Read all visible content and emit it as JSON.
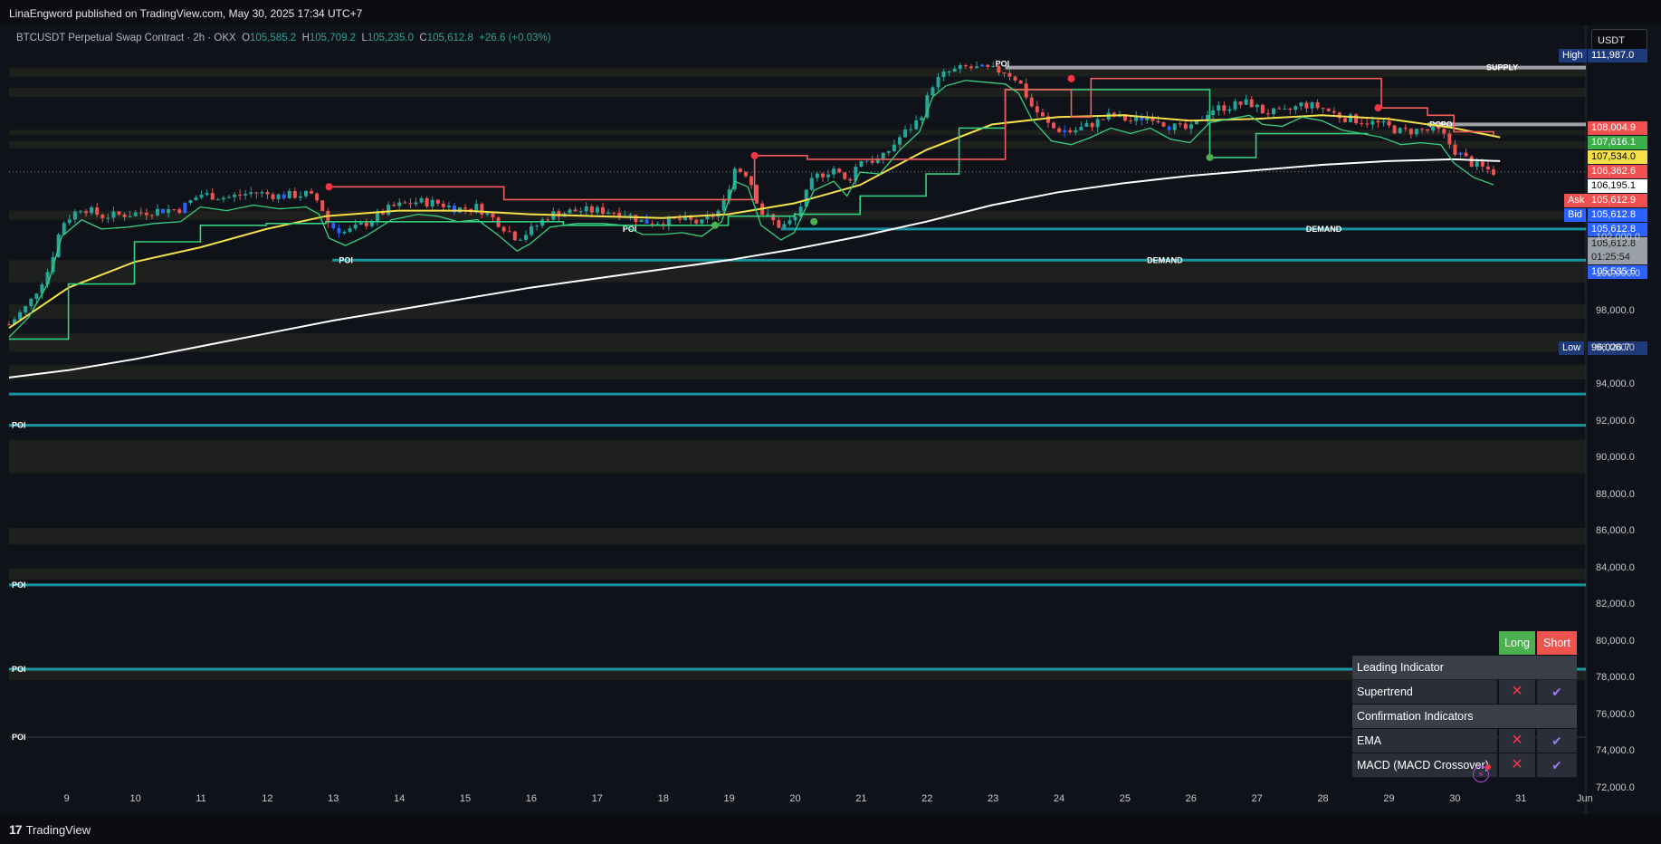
{
  "header": {
    "published": "LinaEngword published on TradingView.com, May 30, 2025 17:34 UTC+7"
  },
  "legend": {
    "symbol": "BTCUSDT Perpetual Swap Contract · 2h · OKX",
    "open_label": "O",
    "open": "105,585.2",
    "high_label": "H",
    "high": "105,709.2",
    "low_label": "L",
    "low": "105,235.0",
    "close_label": "C",
    "close": "105,612.8",
    "change": "+26.6 (+0.03%)"
  },
  "currency_button": "USDT",
  "footer": {
    "brand": "TradingView"
  },
  "colors": {
    "background": "#0f1219",
    "up": "#26a69a",
    "down": "#ef5350",
    "ema_fast": "#f5e04a",
    "ema_slow": "#ffffff",
    "supertrend_up": "#35d07f",
    "supertrend_down": "#f25c5c",
    "demand_line": "#1aa3b0"
  },
  "price_labels": [
    {
      "tag": "High",
      "value": "111,987.0",
      "price": 111987,
      "bg": "#1e3a78",
      "fg": "#ffffff"
    },
    {
      "tag": "",
      "value": "108,004.9",
      "price": 108004.9,
      "bg": "#f05050",
      "fg": "#ffffff"
    },
    {
      "tag": "",
      "value": "107,616.1",
      "price": 107616.1,
      "bg": "#3bb04a",
      "fg": "#ffffff"
    },
    {
      "tag": "",
      "value": "107,534.0",
      "price": 107534.0,
      "bg": "#f5e04a",
      "fg": "#000000"
    },
    {
      "tag": "",
      "value": "106,362.6",
      "price": 106362.6,
      "bg": "#f05050",
      "fg": "#ffffff"
    },
    {
      "tag": "",
      "value": "106,195.1",
      "price": 106195.1,
      "bg": "#ffffff",
      "fg": "#000000"
    },
    {
      "tag": "Ask",
      "value": "105,612.9",
      "price": 105612.9,
      "bg": "#f05050",
      "fg": "#ffffff"
    },
    {
      "tag": "Bid",
      "value": "105,612.8",
      "price": 105612.8,
      "bg": "#2962ff",
      "fg": "#ffffff"
    },
    {
      "tag": "",
      "value": "105,612.8",
      "price": 105612.8,
      "bg": "#2962ff",
      "fg": "#ffffff"
    },
    {
      "tag": "",
      "value": "105,612.8",
      "price": 105612.8,
      "bg": "#9aa0a8",
      "fg": "#1a1a1a",
      "countdown": "01:25:54"
    },
    {
      "tag": "",
      "value": "105,535.6",
      "price": 105535.6,
      "bg": "#2962ff",
      "fg": "#ffffff"
    },
    {
      "tag": "Low",
      "value": "96,026.7",
      "price": 96026.7,
      "bg": "#1e3a78",
      "fg": "#ffffff"
    }
  ],
  "signal_table": {
    "header_long": "Long",
    "header_short": "Short",
    "rows": [
      {
        "kind": "section",
        "label": "Leading Indicator"
      },
      {
        "kind": "item",
        "label": "Supertrend",
        "long": "✕",
        "short": "✔"
      },
      {
        "kind": "section",
        "label": "Confirmation Indicators"
      },
      {
        "kind": "item",
        "label": "EMA",
        "long": "✕",
        "short": "✔"
      },
      {
        "kind": "item",
        "label": "MACD (MACD Crossover)",
        "long": "✕",
        "short": "✔"
      }
    ]
  },
  "chart_data": {
    "type": "candlestick",
    "symbol": "BTCUSDT Perpetual Swap Contract",
    "interval": "2h",
    "exchange": "OKX",
    "ylim": [
      70800,
      113600
    ],
    "y_ticks": [
      72000,
      74000,
      76000,
      78000,
      80000,
      82000,
      84000,
      86000,
      88000,
      90000,
      92000,
      94000,
      96000,
      98000,
      100000,
      102000
    ],
    "y_tick_labels": [
      "72,000.0",
      "74,000.0",
      "76,000.0",
      "78,000.0",
      "80,000.0",
      "82,000.0",
      "84,000.0",
      "86,000.0",
      "88,000.0",
      "90,000.0",
      "92,000.0",
      "94,000.0",
      "96,000.0",
      "98,000.0",
      "100,000.0",
      "102,000.0"
    ],
    "x_ticks": [
      "9",
      "10",
      "11",
      "12",
      "13",
      "14",
      "15",
      "16",
      "17",
      "18",
      "19",
      "20",
      "21",
      "22",
      "23",
      "24",
      "25",
      "26",
      "27",
      "28",
      "29",
      "30",
      "31",
      "Jun"
    ],
    "x_range_days": [
      8.1,
      32.0
    ],
    "close_path": [
      [
        8.1,
        97300
      ],
      [
        8.4,
        98400
      ],
      [
        8.7,
        100300
      ],
      [
        8.9,
        102800
      ],
      [
        9.2,
        103700
      ],
      [
        9.5,
        103200
      ],
      [
        9.9,
        103300
      ],
      [
        10.3,
        103500
      ],
      [
        10.7,
        103600
      ],
      [
        11.0,
        104400
      ],
      [
        11.4,
        104200
      ],
      [
        11.8,
        104500
      ],
      [
        12.2,
        104300
      ],
      [
        12.6,
        104400
      ],
      [
        12.8,
        104000
      ],
      [
        12.95,
        102700
      ],
      [
        13.2,
        102300
      ],
      [
        13.5,
        102800
      ],
      [
        13.9,
        103700
      ],
      [
        14.3,
        104000
      ],
      [
        14.6,
        103900
      ],
      [
        14.9,
        103600
      ],
      [
        15.2,
        103700
      ],
      [
        15.5,
        102900
      ],
      [
        15.8,
        102000
      ],
      [
        16.0,
        102400
      ],
      [
        16.3,
        103300
      ],
      [
        16.7,
        103500
      ],
      [
        17.1,
        103500
      ],
      [
        17.4,
        103400
      ],
      [
        17.7,
        102900
      ],
      [
        18.0,
        102900
      ],
      [
        18.3,
        103000
      ],
      [
        18.6,
        102800
      ],
      [
        18.9,
        103600
      ],
      [
        19.1,
        105800
      ],
      [
        19.3,
        105500
      ],
      [
        19.5,
        103400
      ],
      [
        19.8,
        102600
      ],
      [
        20.0,
        103000
      ],
      [
        20.3,
        105300
      ],
      [
        20.6,
        105800
      ],
      [
        20.8,
        105000
      ],
      [
        21.0,
        106300
      ],
      [
        21.3,
        106200
      ],
      [
        21.6,
        107500
      ],
      [
        21.9,
        108500
      ],
      [
        22.1,
        110400
      ],
      [
        22.3,
        111000
      ],
      [
        22.6,
        111300
      ],
      [
        22.9,
        111200
      ],
      [
        23.2,
        111100
      ],
      [
        23.4,
        110600
      ],
      [
        23.6,
        109200
      ],
      [
        23.9,
        108000
      ],
      [
        24.2,
        107800
      ],
      [
        24.5,
        108200
      ],
      [
        24.8,
        108700
      ],
      [
        25.1,
        108400
      ],
      [
        25.4,
        108700
      ],
      [
        25.7,
        108100
      ],
      [
        26.0,
        107900
      ],
      [
        26.3,
        109000
      ],
      [
        26.6,
        109200
      ],
      [
        26.9,
        109400
      ],
      [
        27.1,
        108900
      ],
      [
        27.4,
        108800
      ],
      [
        27.7,
        109300
      ],
      [
        28.0,
        109100
      ],
      [
        28.3,
        108600
      ],
      [
        28.6,
        108400
      ],
      [
        28.9,
        108200
      ],
      [
        29.2,
        107800
      ],
      [
        29.5,
        107900
      ],
      [
        29.8,
        107800
      ],
      [
        30.0,
        106800
      ],
      [
        30.3,
        106000
      ],
      [
        30.6,
        105612.8
      ]
    ],
    "series": [
      {
        "name": "EMA (fast)",
        "color": "#f5e04a",
        "points": [
          [
            8.1,
            97100
          ],
          [
            9.0,
            99300
          ],
          [
            10.0,
            100700
          ],
          [
            11.0,
            101500
          ],
          [
            12.0,
            102500
          ],
          [
            12.9,
            103200
          ],
          [
            14.0,
            103500
          ],
          [
            15.0,
            103500
          ],
          [
            16.0,
            103300
          ],
          [
            17.0,
            103200
          ],
          [
            18.0,
            103100
          ],
          [
            19.0,
            103300
          ],
          [
            20.0,
            103900
          ],
          [
            21.0,
            104900
          ],
          [
            22.0,
            106800
          ],
          [
            23.0,
            108200
          ],
          [
            24.0,
            108600
          ],
          [
            25.0,
            108700
          ],
          [
            26.0,
            108400
          ],
          [
            27.0,
            108500
          ],
          [
            28.0,
            108700
          ],
          [
            29.0,
            108500
          ],
          [
            30.0,
            108000
          ],
          [
            30.7,
            107500
          ]
        ]
      },
      {
        "name": "EMA (slow)",
        "color": "#ffffff",
        "points": [
          [
            8.1,
            94400
          ],
          [
            9.0,
            94800
          ],
          [
            10.0,
            95400
          ],
          [
            11.0,
            96100
          ],
          [
            12.0,
            96800
          ],
          [
            13.0,
            97500
          ],
          [
            14.0,
            98100
          ],
          [
            15.0,
            98700
          ],
          [
            16.0,
            99300
          ],
          [
            17.0,
            99800
          ],
          [
            18.0,
            100300
          ],
          [
            19.0,
            100800
          ],
          [
            20.0,
            101400
          ],
          [
            21.0,
            102100
          ],
          [
            22.0,
            102900
          ],
          [
            23.0,
            103800
          ],
          [
            24.0,
            104500
          ],
          [
            25.0,
            105000
          ],
          [
            26.0,
            105400
          ],
          [
            27.0,
            105700
          ],
          [
            28.0,
            106000
          ],
          [
            29.0,
            106200
          ],
          [
            30.0,
            106300
          ],
          [
            30.7,
            106200
          ]
        ]
      }
    ],
    "supertrend": {
      "up": [
        [
          8.1,
          96500
        ],
        [
          9.0,
          99500
        ],
        [
          10.0,
          101800
        ],
        [
          11.0,
          102700
        ],
        [
          12.0,
          102800
        ],
        [
          12.9,
          102900
        ],
        [
          16.5,
          102700
        ],
        [
          18.0,
          102700
        ],
        [
          19.0,
          103200
        ],
        [
          20.0,
          103300
        ],
        [
          21.0,
          104300
        ],
        [
          22.0,
          105500
        ],
        [
          22.5,
          108000
        ],
        [
          23.2,
          110100
        ],
        [
          23.7,
          110100
        ],
        [
          26.3,
          106400
        ],
        [
          27.0,
          107700
        ],
        [
          28.0,
          107700
        ],
        [
          28.7,
          107700
        ]
      ],
      "down": [
        [
          12.9,
          104800
        ],
        [
          15.5,
          104800
        ],
        [
          15.6,
          104100
        ],
        [
          18.8,
          104100
        ],
        [
          19.4,
          106500
        ],
        [
          20.2,
          106300
        ],
        [
          21.0,
          106300
        ],
        [
          23.2,
          110100
        ],
        [
          23.6,
          110100
        ],
        [
          24.2,
          108600
        ],
        [
          24.5,
          110700
        ],
        [
          26.0,
          110700
        ],
        [
          26.4,
          110700
        ],
        [
          28.9,
          109100
        ],
        [
          29.6,
          108700
        ],
        [
          30.0,
          107800
        ],
        [
          30.6,
          107600
        ]
      ]
    },
    "signal_dots": [
      {
        "side": "short",
        "x": 12.95,
        "y": 104800
      },
      {
        "side": "short",
        "x": 19.4,
        "y": 106500
      },
      {
        "side": "short",
        "x": 24.2,
        "y": 110700
      },
      {
        "side": "short",
        "x": 28.85,
        "y": 109100
      },
      {
        "side": "long",
        "x": 18.8,
        "y": 102700
      },
      {
        "side": "long",
        "x": 20.3,
        "y": 102900
      },
      {
        "side": "long",
        "x": 26.3,
        "y": 106400
      }
    ],
    "zones": [
      {
        "type": "supply",
        "label": "SUPPLY",
        "from_x": 23.2,
        "price": 111300,
        "color": "#b0b2b8"
      },
      {
        "type": "poi",
        "label": "POI",
        "from_x": 29.6,
        "price": 108200,
        "color": "#b0b2b8"
      },
      {
        "type": "demand",
        "label": "DEMAND",
        "from_x": 19.8,
        "price": 102500,
        "color": "#1aa3b0"
      },
      {
        "type": "demand",
        "label": "DEMAND",
        "from_x": 13.0,
        "price": 100800,
        "color": "#1aa3b0"
      },
      {
        "type": "demand",
        "label": "",
        "from_x": 8.1,
        "price": 93500,
        "color": "#1aa3b0"
      },
      {
        "type": "demand",
        "label": "POI",
        "from_x": 8.1,
        "price": 91800,
        "color": "#1aa3b0"
      },
      {
        "type": "demand",
        "label": "POI",
        "from_x": 8.1,
        "price": 83100,
        "color": "#1aa3b0"
      },
      {
        "type": "demand",
        "label": "POI",
        "from_x": 8.1,
        "price": 78500,
        "color": "#1aa3b0"
      },
      {
        "type": "level",
        "label": "POI",
        "from_x": 8.1,
        "price": 74800,
        "color": "#3a3e48"
      }
    ],
    "text_labels": [
      {
        "text": "POI",
        "x": 23.05,
        "y": 111500
      },
      {
        "text": "POI",
        "x": 13.1,
        "y": 100800
      },
      {
        "text": "POI",
        "x": 17.4,
        "y": 102500
      },
      {
        "text": "POI",
        "x": 29.8,
        "y": 108200
      }
    ],
    "bands": [
      [
        110800,
        111300
      ],
      [
        109700,
        110200
      ],
      [
        107600,
        107900
      ],
      [
        106900,
        107300
      ],
      [
        103000,
        103500
      ],
      [
        99600,
        100800
      ],
      [
        97600,
        98400
      ],
      [
        95800,
        96800
      ],
      [
        94300,
        95100
      ],
      [
        89200,
        91000
      ],
      [
        85300,
        86200
      ],
      [
        83400,
        84000
      ],
      [
        77900,
        78600
      ]
    ]
  }
}
